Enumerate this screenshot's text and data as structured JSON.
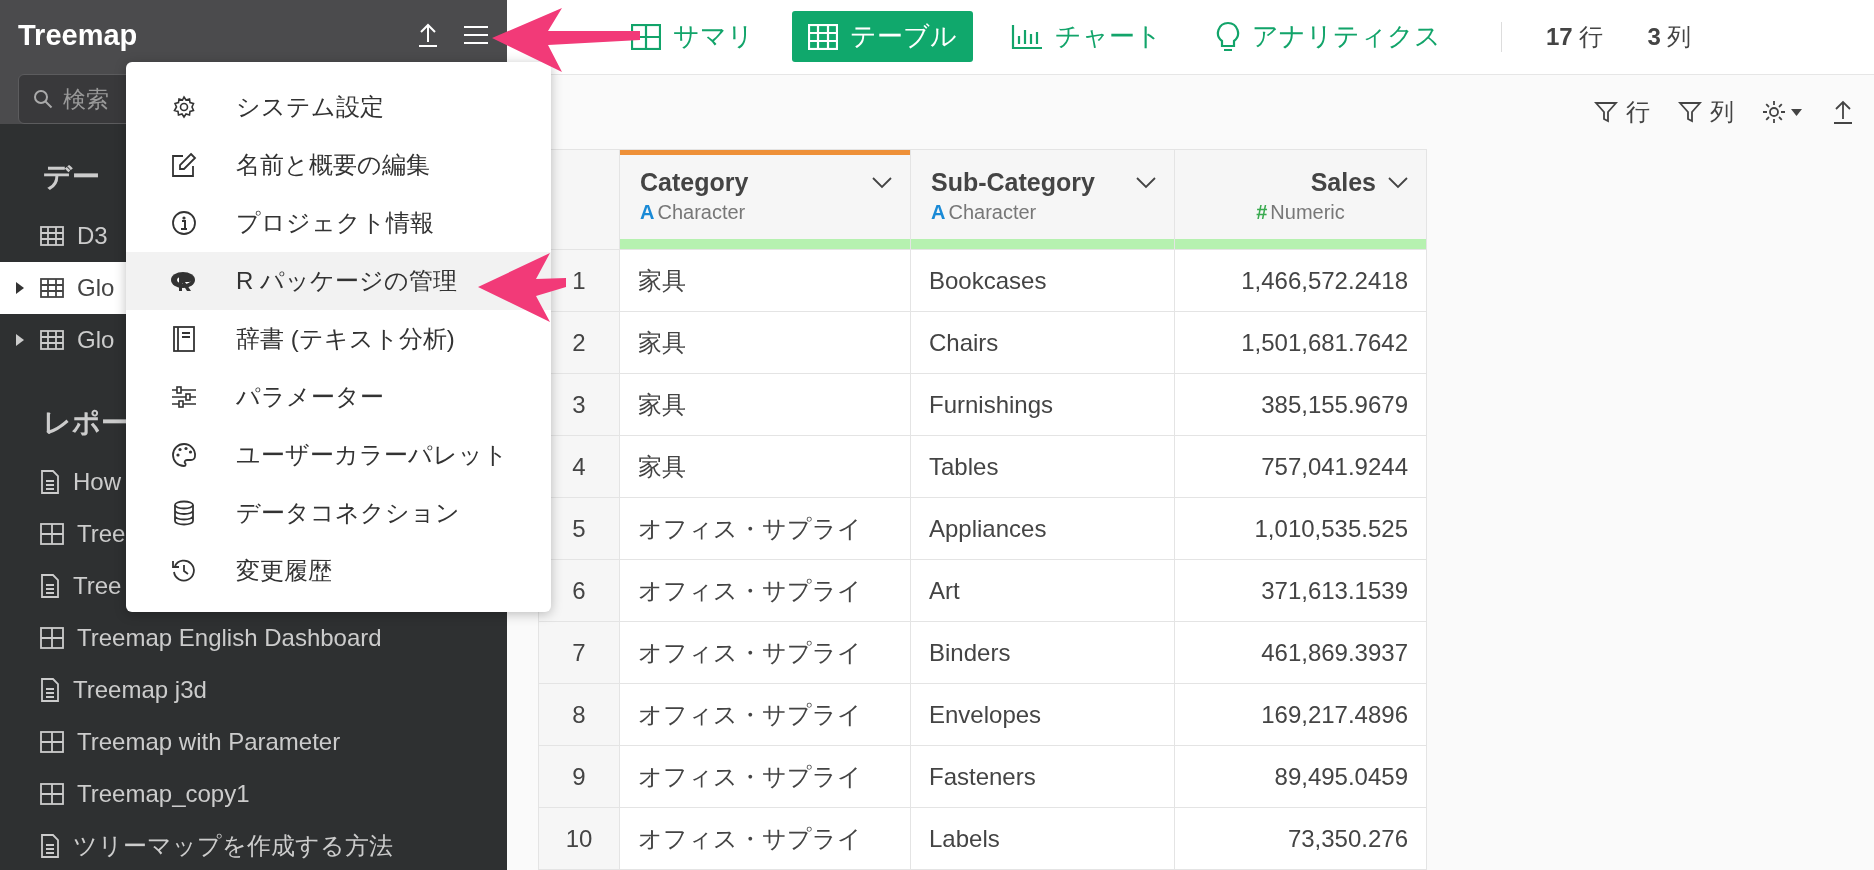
{
  "sidebar": {
    "title": "Treemap",
    "search": {
      "placeholder": "検索"
    },
    "sections": [
      {
        "title": "デー",
        "items": [
          {
            "label": "D3",
            "kind": "table",
            "selected": false,
            "expandable": false
          },
          {
            "label": "Glo",
            "kind": "table",
            "selected": true,
            "expandable": true
          },
          {
            "label": "Glo",
            "kind": "table",
            "selected": false,
            "expandable": true
          }
        ]
      },
      {
        "title": "レポー",
        "items": [
          {
            "label": "How",
            "kind": "document",
            "selected": false,
            "expandable": false
          },
          {
            "label": "Tree",
            "kind": "dashboard",
            "selected": false,
            "expandable": false
          },
          {
            "label": "Tree",
            "kind": "document",
            "selected": false,
            "expandable": false
          },
          {
            "label": "Treemap English Dashboard",
            "kind": "dashboard",
            "selected": false,
            "expandable": false
          },
          {
            "label": "Treemap j3d",
            "kind": "document",
            "selected": false,
            "expandable": false
          },
          {
            "label": "Treemap with Parameter",
            "kind": "dashboard",
            "selected": false,
            "expandable": false
          },
          {
            "label": "Treemap_copy1",
            "kind": "dashboard",
            "selected": false,
            "expandable": false
          },
          {
            "label": "ツリーマップを作成する方法",
            "kind": "document",
            "selected": false,
            "expandable": false
          }
        ]
      }
    ]
  },
  "menu": {
    "items": [
      {
        "label": "システム設定",
        "selected": false
      },
      {
        "label": "名前と概要の編集",
        "selected": false
      },
      {
        "label": "プロジェクト情報",
        "selected": false
      },
      {
        "label": "R パッケージの管理",
        "selected": true
      },
      {
        "label": "辞書 (テキスト分析)",
        "selected": false
      },
      {
        "label": "パラメーター",
        "selected": false
      },
      {
        "label": "ユーザーカラーパレット",
        "selected": false
      },
      {
        "label": "データコネクション",
        "selected": false
      },
      {
        "label": "変更履歴",
        "selected": false
      }
    ]
  },
  "nav_tabs": [
    {
      "label": "サマリ",
      "selected": false
    },
    {
      "label": "テーブル",
      "selected": true
    },
    {
      "label": "チャート",
      "selected": false
    },
    {
      "label": "アナリティクス",
      "selected": false
    }
  ],
  "counts": [
    {
      "value": "17",
      "unit": "行"
    },
    {
      "value": "3",
      "unit": "列"
    }
  ],
  "toolbar": {
    "row_filter": "行",
    "column_filter": "列"
  },
  "table": {
    "columns": [
      {
        "name": "Category",
        "kind": "character",
        "type_icon": "A",
        "type_label": "Character",
        "selected": true,
        "level": 1
      },
      {
        "name": "Sub-Category",
        "kind": "character",
        "type_icon": "A",
        "type_label": "Character",
        "selected": false,
        "level": 1
      },
      {
        "name": "Sales",
        "kind": "numeric",
        "type_icon": "#",
        "type_label": "Numeric",
        "selected": false,
        "level": 1
      }
    ],
    "rows": [
      {
        "number": "1",
        "cells": [
          "家具",
          "Bookcases",
          "1,466,572.2418"
        ]
      },
      {
        "number": "2",
        "cells": [
          "家具",
          "Chairs",
          "1,501,681.7642"
        ]
      },
      {
        "number": "3",
        "cells": [
          "家具",
          "Furnishings",
          "385,155.9679"
        ]
      },
      {
        "number": "4",
        "cells": [
          "家具",
          "Tables",
          "757,041.9244"
        ]
      },
      {
        "number": "5",
        "cells": [
          "オフィス・サプライ",
          "Appliances",
          "1,010,535.525"
        ]
      },
      {
        "number": "6",
        "cells": [
          "オフィス・サプライ",
          "Art",
          "371,613.1539"
        ]
      },
      {
        "number": "7",
        "cells": [
          "オフィス・サプライ",
          "Binders",
          "461,869.3937"
        ]
      },
      {
        "number": "8",
        "cells": [
          "オフィス・サプライ",
          "Envelopes",
          "169,217.4896"
        ]
      },
      {
        "number": "9",
        "cells": [
          "オフィス・サプライ",
          "Fasteners",
          "89,495.0459"
        ]
      },
      {
        "number": "10",
        "cells": [
          "オフィス・サプライ",
          "Labels",
          "73,350.276"
        ]
      }
    ]
  }
}
